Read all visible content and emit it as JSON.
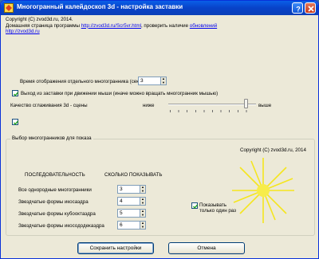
{
  "window": {
    "title": "Многогранный калейдоскоп 3d - настройка заставки",
    "help_icon": "question-icon",
    "close_icon": "close-x-icon"
  },
  "intro": {
    "line1": "",
    "line2": "",
    "line3": "",
    "line4": "",
    "line5": "",
    "copyright": "Copyright (C) zvod3d.ru, 2014.",
    "home_prefix": "Домашняя страница программы",
    "home_link": "http://zvod3d.ru/Scr5vr.html",
    "home_mid": ", проверить наличие",
    "updates_link": "обновлений",
    "more_text": "",
    "more_link": "http://zvod3d.ru"
  },
  "display_time": {
    "label": "Время отображения отдельного многогранника (сек.):",
    "value": "3"
  },
  "exit_on_mouse": {
    "label": "Выход из заставки при движении мыши (иначе можно вращать многогранник мышью)",
    "checked": true
  },
  "smoothing": {
    "label": "Качество сглаживания 3d - сцены",
    "low": "ниже",
    "high": "выше",
    "level": 0.9
  },
  "fullscreen": {
    "label_line1": "",
    "label_line2": "",
    "checked": true
  },
  "polyhedra_group": {
    "title": "Выбор многогранников для показа",
    "desc_line1": "",
    "desc_line2": "",
    "desc_line3": "",
    "col_order": "ПОСЛЕДОВАТЕЛЬНОСТЬ",
    "col_count": "СКОЛЬКО ПОКАЗЫВАТЬ",
    "rows": [
      {
        "label": "Все однородные многогранники",
        "value": "3"
      },
      {
        "label": "Звездчатые формы икосаэдра",
        "value": "4"
      },
      {
        "label": "Звездчатые формы кубооктаэдра",
        "value": "5"
      },
      {
        "label": "Звездчатые формы икосододекаэдра",
        "value": "6"
      }
    ],
    "show_once_line1": "Показывать",
    "show_once_line2": "только один раз",
    "show_once_checked": true,
    "copyright": "Copyright (C) zvod3d.ru, 2014"
  },
  "buttons": {
    "save": "Сохранить настройки",
    "cancel": "Отмена"
  },
  "colors": {
    "titlebar": "#0a5fe8",
    "sun": "#f5e61e",
    "link": "#0000ee"
  }
}
